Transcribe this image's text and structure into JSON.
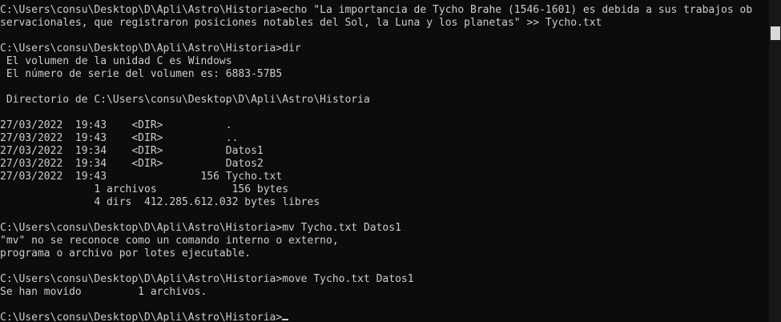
{
  "terminal": {
    "lines": [
      "C:\\Users\\consu\\Desktop\\D\\Apli\\Astro\\Historia>echo \"La importancia de Tycho Brahe (1546-1601) es debida a sus trabajos ob",
      "servacionales, que registraron posiciones notables del Sol, la Luna y los planetas\" >> Tycho.txt",
      "",
      "C:\\Users\\consu\\Desktop\\D\\Apli\\Astro\\Historia>dir",
      " El volumen de la unidad C es Windows",
      " El número de serie del volumen es: 6883-57B5",
      "",
      " Directorio de C:\\Users\\consu\\Desktop\\D\\Apli\\Astro\\Historia",
      "",
      "27/03/2022  19:43    <DIR>          .",
      "27/03/2022  19:43    <DIR>          ..",
      "27/03/2022  19:34    <DIR>          Datos1",
      "27/03/2022  19:34    <DIR>          Datos2",
      "27/03/2022  19:43               156 Tycho.txt",
      "               1 archivos            156 bytes",
      "               4 dirs  412.285.612.032 bytes libres",
      "",
      "C:\\Users\\consu\\Desktop\\D\\Apli\\Astro\\Historia>mv Tycho.txt Datos1",
      "\"mv\" no se reconoce como un comando interno o externo,",
      "programa o archivo por lotes ejecutable.",
      "",
      "C:\\Users\\consu\\Desktop\\D\\Apli\\Astro\\Historia>move Tycho.txt Datos1",
      "Se han movido         1 archivos.",
      ""
    ],
    "prompt": "C:\\Users\\consu\\Desktop\\D\\Apli\\Astro\\Historia>"
  },
  "colors": {
    "background": "#0c0c0c",
    "text": "#cccccc",
    "scrollbar_track": "#171717",
    "scrollbar_thumb": "#d9d9d9"
  }
}
